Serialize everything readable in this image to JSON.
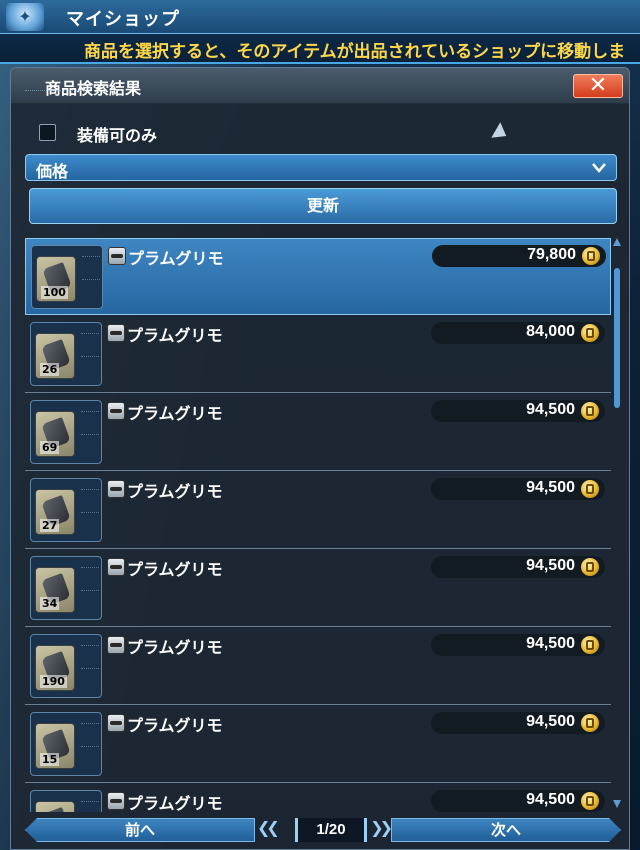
{
  "header": {
    "title": "マイショップ",
    "hint": "商品を選択すると、そのアイテムが出品されているショップに移動しま"
  },
  "window": {
    "title": "商品検索結果",
    "close_label": "✕"
  },
  "filters": {
    "equip_only_label": "装備可のみ",
    "equip_only_checked": false,
    "sort_value": "価格",
    "update_label": "更新"
  },
  "results": [
    {
      "name": "プラムグリモ",
      "qty": "100",
      "price": "79,800",
      "selected": true
    },
    {
      "name": "プラムグリモ",
      "qty": "26",
      "price": "84,000",
      "selected": false
    },
    {
      "name": "プラムグリモ",
      "qty": "69",
      "price": "94,500",
      "selected": false
    },
    {
      "name": "プラムグリモ",
      "qty": "27",
      "price": "94,500",
      "selected": false
    },
    {
      "name": "プラムグリモ",
      "qty": "34",
      "price": "94,500",
      "selected": false
    },
    {
      "name": "プラムグリモ",
      "qty": "190",
      "price": "94,500",
      "selected": false
    },
    {
      "name": "プラムグリモ",
      "qty": "15",
      "price": "94,500",
      "selected": false
    },
    {
      "name": "プラムグリモ",
      "qty": "",
      "price": "94,500",
      "selected": false
    }
  ],
  "pager": {
    "prev_label": "前へ",
    "next_label": "次へ",
    "page": "1/20"
  },
  "colors": {
    "accent": "#3e86c2",
    "hint_text": "#ffd84a",
    "close": "#d23d1d"
  }
}
